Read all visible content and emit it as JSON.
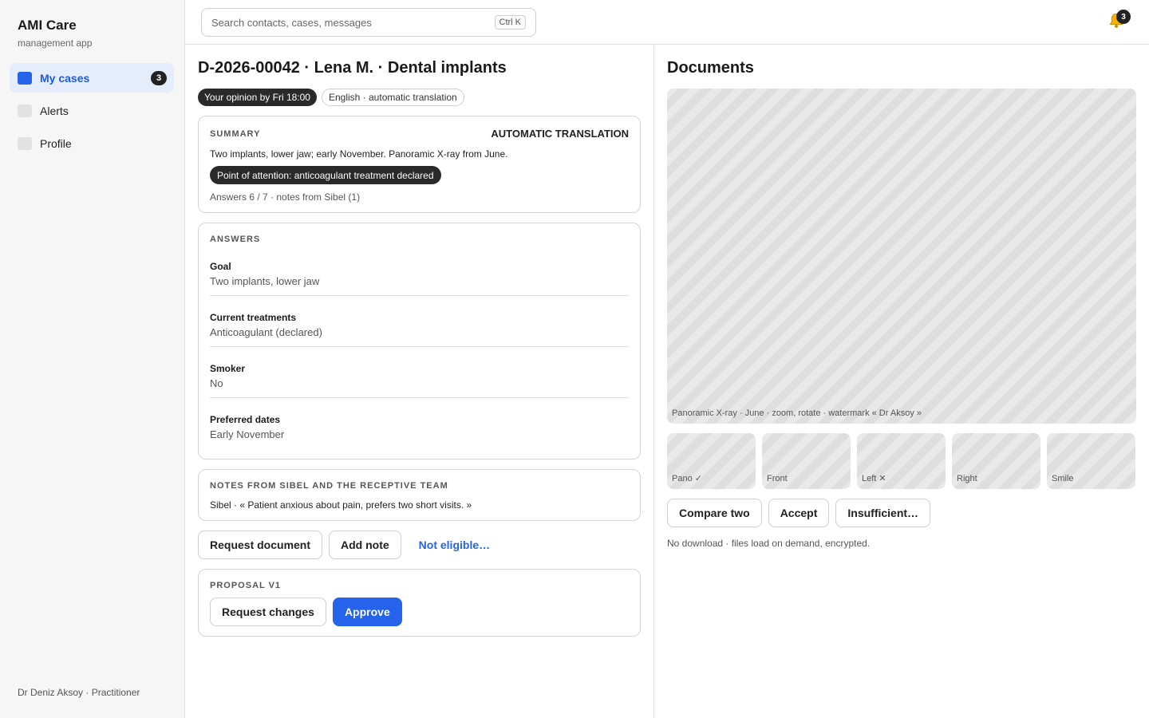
{
  "app": {
    "title": "AMI Care",
    "subtitle": "management app"
  },
  "sidebar": {
    "items": [
      {
        "label": "My cases",
        "badge": "3",
        "active": true
      },
      {
        "label": "Alerts"
      },
      {
        "label": "Profile"
      }
    ],
    "footer": "Dr Deniz Aksoy · Practitioner"
  },
  "topbar": {
    "search_placeholder": "Search contacts, cases, messages",
    "search_shortcut": "Ctrl K",
    "notifications_count": "3",
    "bell_icon": "bell-icon"
  },
  "case": {
    "title": "D-2026-00042 · Lena M. · Dental implants",
    "chips": {
      "deadline": "Your opinion by Fri 18:00",
      "language": "English · automatic translation"
    },
    "summary": {
      "label": "SUMMARY",
      "translation_label": "AUTOMATIC TRANSLATION",
      "text": "Two implants, lower jaw; early November. Panoramic X-ray from June.",
      "attention": "Point of attention: anticoagulant treatment declared",
      "meta": "Answers 6 / 7 · notes from Sibel (1)"
    },
    "answers": {
      "label": "ANSWERS",
      "items": [
        {
          "q": "Goal",
          "a": "Two implants, lower jaw"
        },
        {
          "q": "Current treatments",
          "a": "Anticoagulant (declared)"
        },
        {
          "q": "Smoker",
          "a": "No"
        },
        {
          "q": "Preferred dates",
          "a": "Early November"
        }
      ]
    },
    "notes": {
      "label": "NOTES FROM SIBEL AND THE RECEPTIVE TEAM",
      "text": "Sibel · « Patient anxious about pain, prefers two short visits. »"
    },
    "actions": {
      "request_document": "Request document",
      "add_note": "Add note",
      "not_eligible": "Not eligible…"
    },
    "proposal": {
      "label": "PROPOSAL V1",
      "request_changes": "Request changes",
      "approve": "Approve"
    }
  },
  "documents": {
    "title": "Documents",
    "viewer_caption": "Panoramic X-ray · June · zoom, rotate · watermark « Dr Aksoy »",
    "thumbnails": [
      "Pano ✓",
      "Front",
      "Left ✕",
      "Right",
      "Smile"
    ],
    "actions": {
      "compare": "Compare two",
      "accept": "Accept",
      "insufficient": "Insufficient…"
    },
    "note": "No download · files load on demand, encrypted."
  },
  "colors": {
    "accent": "#2563eb",
    "dark_chip": "#2a2a2a",
    "active_nav_bg": "#e5ecfb"
  }
}
